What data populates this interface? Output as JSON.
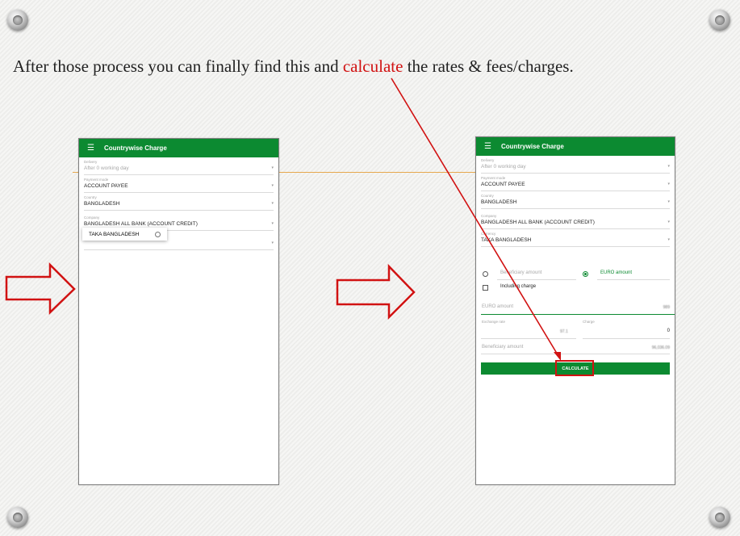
{
  "slide": {
    "heading": {
      "before": "After those process you can finally find this and ",
      "highlight": "calculate",
      "after": " the rates & fees/charges."
    }
  },
  "left_phone": {
    "appbar_title": "Countrywise Charge",
    "fields": [
      {
        "label": "Delivery",
        "value": "After 0 working day"
      },
      {
        "label": "Payment mode",
        "value": "ACCOUNT PAYEE"
      },
      {
        "label": "Country",
        "value": "BANGLADESH"
      },
      {
        "label": "Company",
        "value": "BANGLADESH ALL BANK (ACCOUNT CREDIT)"
      }
    ],
    "popup_option": "TAKA BANGLADESH"
  },
  "right_phone": {
    "appbar_title": "Countrywise Charge",
    "fields": [
      {
        "label": "Delivery",
        "value": "After 0 working day"
      },
      {
        "label": "Payment mode",
        "value": "ACCOUNT PAYEE"
      },
      {
        "label": "Country",
        "value": "BANGLADESH"
      },
      {
        "label": "Company",
        "value": "BANGLADESH ALL BANK (ACCOUNT CREDIT)"
      },
      {
        "label": "Currency",
        "value": "TAKA BANGLADESH"
      }
    ],
    "beneficiary_amount_option": "Beneficiary amount",
    "euro_amount_option": "EURO amount",
    "including_charge": "Including charge",
    "euro_amount_label": "EURO amount",
    "euro_amount_value": "989",
    "exchange_rate_label": "Exchange rate",
    "exchange_rate_value": "97.1",
    "charge_label": "Charge",
    "charge_value": "0",
    "beneficiary_amount_label": "Beneficiary amount",
    "beneficiary_amount_value": "96,036.09",
    "calculate_label": "CALCULATE"
  },
  "colors": {
    "appbar": "#0c8a31",
    "highlight": "#d11212",
    "arrow": "#d11212"
  },
  "icons": [
    "menu-icon",
    "dropdown-arrow-icon",
    "radio-icon",
    "checkbox-icon",
    "right-arrow-icon",
    "screw-icon"
  ]
}
